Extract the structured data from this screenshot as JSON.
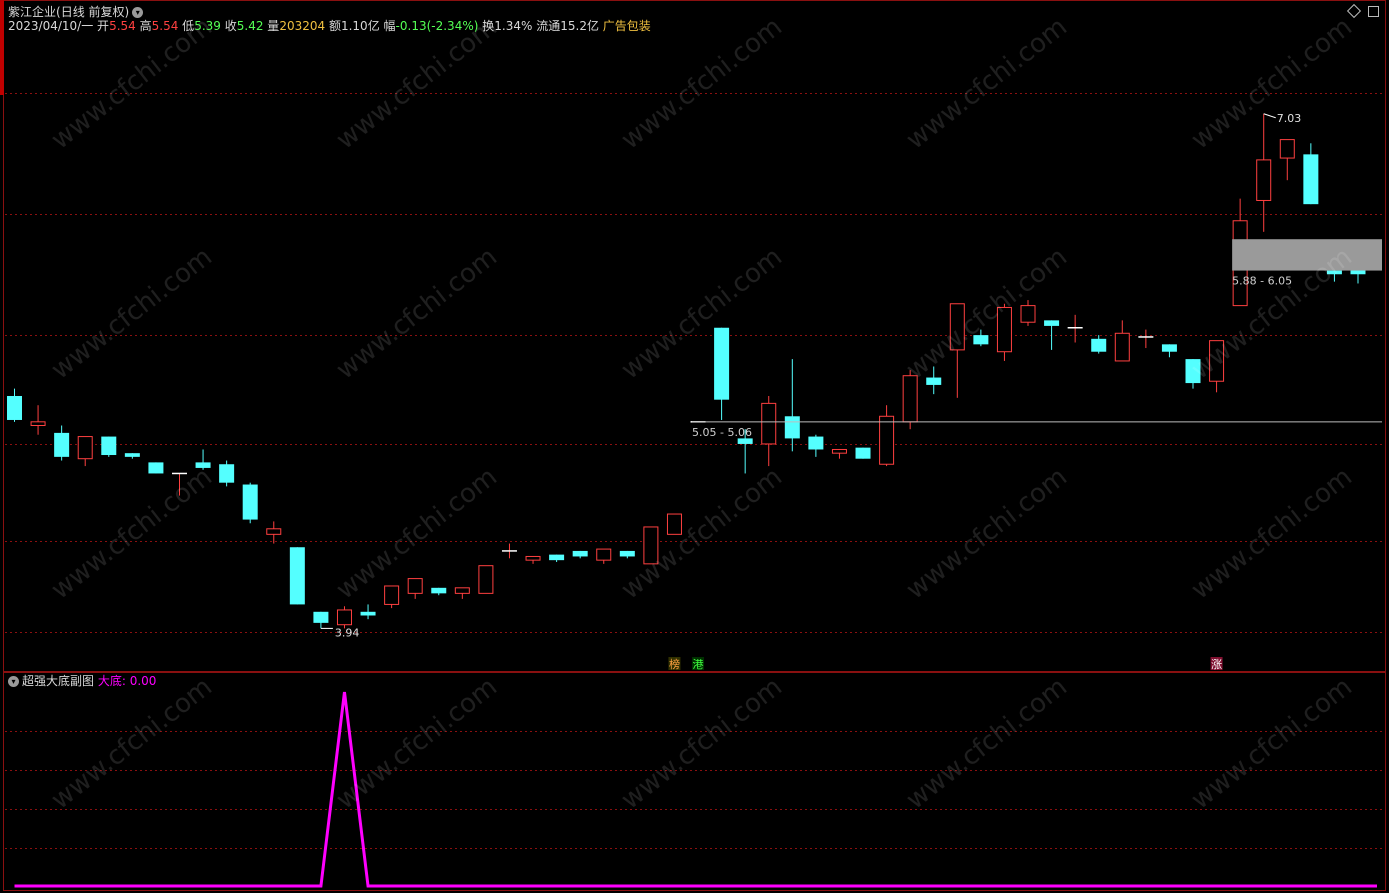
{
  "header": {
    "name": "紫江企业",
    "period": "(日线 前复权)",
    "date": "2023/04/10/一",
    "open_label": "开",
    "open": "5.54",
    "high_label": "高",
    "high": "5.54",
    "low_label": "低",
    "low": "5.39",
    "close_label": "收",
    "close": "5.42",
    "vol_label": "量",
    "vol": "203204",
    "amt_label": "额",
    "amt": "1.10亿",
    "chg_label": "幅",
    "chg": "-0.13(-2.34%)",
    "turn_label": "换",
    "turn": "1.34%",
    "float_label": "流通",
    "float": "15.2亿",
    "sector": "广告包装"
  },
  "sub": {
    "title": "超强大底副图",
    "series_label": "大底:",
    "value": "0.00"
  },
  "colors": {
    "up": "#ff4040",
    "down": "#54ffff",
    "grid": "#8a1010",
    "indicator": "#ff00ff",
    "zone": "#9a9a9a"
  },
  "chart_data": {
    "type": "candlestick",
    "ylim": [
      3.85,
      7.13
    ],
    "candles": [
      {
        "o": 5.2,
        "h": 5.24,
        "l": 5.06,
        "c": 5.07
      },
      {
        "o": 5.04,
        "h": 5.15,
        "l": 4.99,
        "c": 5.06
      },
      {
        "o": 5.0,
        "h": 5.04,
        "l": 4.85,
        "c": 4.87
      },
      {
        "o": 4.86,
        "h": 4.98,
        "l": 4.82,
        "c": 4.98
      },
      {
        "o": 4.98,
        "h": 4.98,
        "l": 4.87,
        "c": 4.88
      },
      {
        "o": 4.89,
        "h": 4.89,
        "l": 4.86,
        "c": 4.87
      },
      {
        "o": 4.84,
        "h": 4.84,
        "l": 4.78,
        "c": 4.78
      },
      {
        "o": 4.78,
        "h": 4.78,
        "l": 4.66,
        "c": 4.78
      },
      {
        "o": 4.84,
        "h": 4.91,
        "l": 4.8,
        "c": 4.81
      },
      {
        "o": 4.83,
        "h": 4.85,
        "l": 4.71,
        "c": 4.73
      },
      {
        "o": 4.72,
        "h": 4.73,
        "l": 4.51,
        "c": 4.53
      },
      {
        "o": 4.45,
        "h": 4.52,
        "l": 4.4,
        "c": 4.48
      },
      {
        "o": 4.38,
        "h": 4.38,
        "l": 4.07,
        "c": 4.07
      },
      {
        "o": 4.03,
        "h": 4.03,
        "l": 3.94,
        "c": 3.97
      },
      {
        "o": 3.96,
        "h": 4.06,
        "l": 3.94,
        "c": 4.04
      },
      {
        "o": 4.03,
        "h": 4.07,
        "l": 3.99,
        "c": 4.01
      },
      {
        "o": 4.07,
        "h": 4.12,
        "l": 4.05,
        "c": 4.17
      },
      {
        "o": 4.13,
        "h": 4.18,
        "l": 4.1,
        "c": 4.21
      },
      {
        "o": 4.16,
        "h": 4.16,
        "l": 4.12,
        "c": 4.13
      },
      {
        "o": 4.13,
        "h": 4.15,
        "l": 4.1,
        "c": 4.16
      },
      {
        "o": 4.13,
        "h": 4.21,
        "l": 4.13,
        "c": 4.28
      },
      {
        "o": 4.36,
        "h": 4.4,
        "l": 4.32,
        "c": 4.36
      },
      {
        "o": 4.31,
        "h": 4.33,
        "l": 4.29,
        "c": 4.33
      },
      {
        "o": 4.34,
        "h": 4.34,
        "l": 4.3,
        "c": 4.31
      },
      {
        "o": 4.36,
        "h": 4.36,
        "l": 4.32,
        "c": 4.33
      },
      {
        "o": 4.31,
        "h": 4.37,
        "l": 4.29,
        "c": 4.37
      },
      {
        "o": 4.36,
        "h": 4.36,
        "l": 4.32,
        "c": 4.33
      },
      {
        "o": 4.29,
        "h": 4.44,
        "l": 4.29,
        "c": 4.49
      },
      {
        "o": 4.45,
        "h": 4.56,
        "l": 4.45,
        "c": 4.56
      },
      {
        "o": 5.06,
        "h": 5.06,
        "l": 5.06,
        "c": 5.06
      },
      {
        "o": 5.57,
        "h": 5.57,
        "l": 5.07,
        "c": 5.18
      },
      {
        "o": 4.97,
        "h": 5.02,
        "l": 4.78,
        "c": 4.94
      },
      {
        "o": 4.94,
        "h": 5.2,
        "l": 4.82,
        "c": 5.16
      },
      {
        "o": 5.09,
        "h": 5.4,
        "l": 4.9,
        "c": 4.97
      },
      {
        "o": 4.98,
        "h": 4.99,
        "l": 4.87,
        "c": 4.91
      },
      {
        "o": 4.89,
        "h": 4.91,
        "l": 4.86,
        "c": 4.91
      },
      {
        "o": 4.92,
        "h": 4.92,
        "l": 4.86,
        "c": 4.86
      },
      {
        "o": 4.83,
        "h": 5.15,
        "l": 4.82,
        "c": 5.09
      },
      {
        "o": 5.06,
        "h": 5.34,
        "l": 5.02,
        "c": 5.31
      },
      {
        "o": 5.3,
        "h": 5.36,
        "l": 5.21,
        "c": 5.26
      },
      {
        "o": 5.45,
        "h": 5.65,
        "l": 5.19,
        "c": 5.7
      },
      {
        "o": 5.53,
        "h": 5.56,
        "l": 5.47,
        "c": 5.48
      },
      {
        "o": 5.44,
        "h": 5.7,
        "l": 5.39,
        "c": 5.68
      },
      {
        "o": 5.6,
        "h": 5.72,
        "l": 5.58,
        "c": 5.69
      },
      {
        "o": 5.61,
        "h": 5.61,
        "l": 5.45,
        "c": 5.58
      },
      {
        "o": 5.57,
        "h": 5.64,
        "l": 5.49,
        "c": 5.57
      },
      {
        "o": 5.51,
        "h": 5.53,
        "l": 5.43,
        "c": 5.44
      },
      {
        "o": 5.39,
        "h": 5.61,
        "l": 5.39,
        "c": 5.54
      },
      {
        "o": 5.52,
        "h": 5.56,
        "l": 5.46,
        "c": 5.52
      },
      {
        "o": 5.48,
        "h": 5.48,
        "l": 5.41,
        "c": 5.44
      },
      {
        "o": 5.4,
        "h": 5.4,
        "l": 5.24,
        "c": 5.27
      },
      {
        "o": 5.28,
        "h": 5.5,
        "l": 5.22,
        "c": 5.5
      },
      {
        "o": 5.69,
        "h": 6.27,
        "l": 5.69,
        "c": 6.15
      },
      {
        "o": 6.26,
        "h": 6.73,
        "l": 6.09,
        "c": 6.48
      },
      {
        "o": 6.49,
        "h": 6.5,
        "l": 6.37,
        "c": 6.59
      },
      {
        "o": 6.51,
        "h": 6.57,
        "l": 6.24,
        "c": 6.24
      },
      {
        "o": 5.88,
        "h": 5.95,
        "l": 5.82,
        "c": 5.86
      },
      {
        "o": 5.92,
        "h": 5.95,
        "l": 5.81,
        "c": 5.86
      }
    ],
    "indicator": [
      0,
      0,
      0,
      0,
      0,
      0,
      0,
      0,
      0,
      0,
      0,
      0,
      0,
      0,
      1,
      0,
      0,
      0,
      0,
      0,
      0,
      0,
      0,
      0,
      0,
      0,
      0,
      0,
      0,
      0,
      0,
      0,
      0,
      0,
      0,
      0,
      0,
      0,
      0,
      0,
      0,
      0,
      0,
      0,
      0,
      0,
      0,
      0,
      0,
      0,
      0,
      0,
      0,
      0,
      0,
      0,
      0,
      0
    ],
    "annotations": {
      "high_label": "7.03",
      "low_label": "3.94",
      "mid_zone_label": "5.05 - 5.06",
      "upper_zone_label": "5.88 - 6.05",
      "flags": [
        {
          "index": 28,
          "text": "榜"
        },
        {
          "index": 29,
          "text": "港"
        },
        {
          "index": 51,
          "text": "涨"
        }
      ]
    }
  }
}
